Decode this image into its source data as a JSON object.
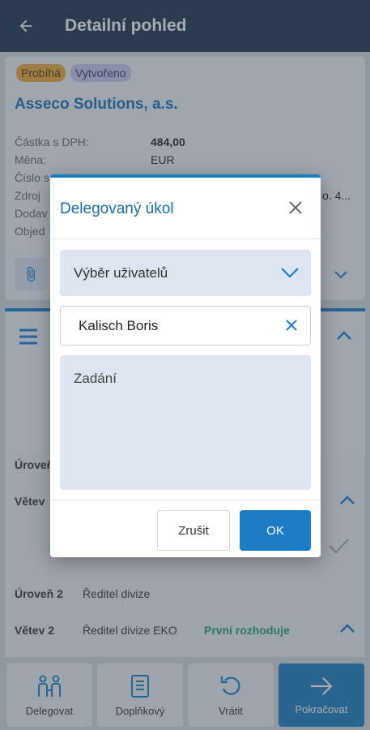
{
  "appbar": {
    "title": "Detailní pohled",
    "back_icon": "arrow-left-icon"
  },
  "header_card": {
    "badges": [
      "Probíhá",
      "Vytvořeno"
    ],
    "company": "Asseco Solutions, a.s.",
    "fields": [
      {
        "label": "Částka s DPH:",
        "value": "484,00"
      },
      {
        "label": "Měna:",
        "value": "EUR"
      },
      {
        "label": "Číslo s",
        "value": ""
      },
      {
        "label": "Zdroj",
        "value": "o. 4..."
      },
      {
        "label": "Dodav",
        "value": ""
      },
      {
        "label": "Objed",
        "value": ""
      }
    ]
  },
  "approval": {
    "rows": [
      {
        "label": "Úroveň",
        "value": ""
      },
      {
        "label": "Větev",
        "value": ""
      },
      {
        "label": "Úroveň 2",
        "value": "Ředitel divize"
      },
      {
        "label": "Větev 2",
        "value": "Ředitel divize EKO",
        "status": "První rozhoduje"
      }
    ]
  },
  "dialog": {
    "title": "Delegovaný úkol",
    "select_placeholder": "Výběr uživatelů",
    "selected_user": "Kalisch Boris",
    "assignment_placeholder": "Zadání",
    "cancel_label": "Zrušit",
    "ok_label": "OK"
  },
  "bottom_actions": [
    {
      "label": "Delegovat",
      "icon": "people-icon"
    },
    {
      "label": "Doplňkový",
      "icon": "document-icon"
    },
    {
      "label": "Vrátit",
      "icon": "undo-icon"
    },
    {
      "label": "Pokračovat",
      "icon": "arrow-right-icon"
    }
  ],
  "colors": {
    "primary": "#1c7dc4",
    "appbar": "#1f3147",
    "field_bg": "#dde6f0",
    "status_green": "#2a9c6a"
  }
}
